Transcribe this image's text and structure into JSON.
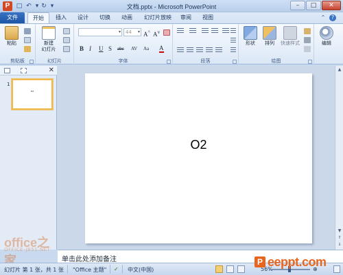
{
  "window": {
    "title": "文档.pptx - Microsoft PowerPoint",
    "app_logo": "P",
    "qat_icons": [
      "save-icon",
      "undo-icon",
      "redo-icon",
      "customize-qat-icon"
    ]
  },
  "tabs": [
    {
      "label": "文件",
      "selected": false
    },
    {
      "label": "开始",
      "selected": true
    },
    {
      "label": "插入",
      "selected": false
    },
    {
      "label": "设计",
      "selected": false
    },
    {
      "label": "切换",
      "selected": false
    },
    {
      "label": "动画",
      "selected": false
    },
    {
      "label": "幻灯片放映",
      "selected": false
    },
    {
      "label": "审阅",
      "selected": false
    },
    {
      "label": "视图",
      "selected": false
    }
  ],
  "ribbon": {
    "clipboard": {
      "paste_label": "粘贴",
      "group_label": "剪贴板"
    },
    "slides": {
      "new_slide_label": "新建\n幻灯片",
      "new_slide_line1": "新建",
      "new_slide_line2": "幻灯片",
      "group_label": "幻灯片"
    },
    "font": {
      "font_size": "44",
      "group_label": "字体",
      "buttons": [
        "B",
        "I",
        "U",
        "S",
        "abc",
        "AV",
        "Aa",
        "A"
      ]
    },
    "paragraph": {
      "group_label": "段落"
    },
    "drawing": {
      "shapes_label": "形状",
      "arrange_label": "排列",
      "quick_styles_label": "快速样式",
      "group_label": "绘图"
    },
    "editing": {
      "label": "编辑"
    }
  },
  "slide_panel": {
    "slide_number": "1",
    "thumb_text": "O2"
  },
  "slide": {
    "text": "O2"
  },
  "notes": {
    "placeholder": "单击此处添加备注"
  },
  "status": {
    "slide_info": "幻灯片 第 1 张，共 1 张",
    "theme": "\"Office 主题\"",
    "language": "中文(中国)",
    "zoom": "56%"
  },
  "watermarks": {
    "office_home": "office之家",
    "office_home_sub": "OFFICE-JB51.NET",
    "eeppt": "eeppt.com",
    "eeppt_mark": "P"
  },
  "colors": {
    "file_tab": "#1e55a7",
    "selection": "#f3b84d",
    "accent": "#d24726"
  }
}
